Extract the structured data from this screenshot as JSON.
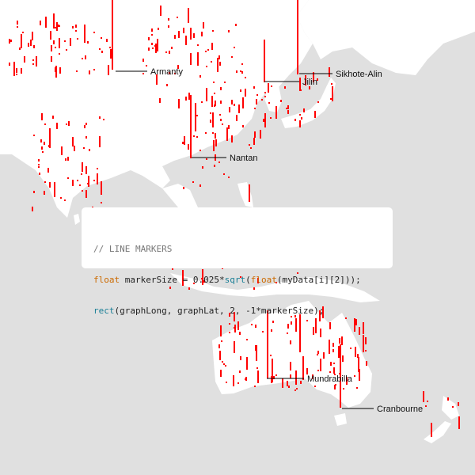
{
  "colors": {
    "ocean": "#e0e0e0",
    "land": "#ffffff",
    "marker": "#ff0000",
    "label": "#111111"
  },
  "places": [
    {
      "name": "Armanty"
    },
    {
      "name": "Jilin"
    },
    {
      "name": "Sikhote-Alin"
    },
    {
      "name": "Nantan"
    },
    {
      "name": "Mundrabilla"
    },
    {
      "name": "Cranbourne"
    }
  ],
  "code_overlay": {
    "comment": "// LINE MARKERS",
    "line1": {
      "type": "float",
      "var": " markerSize = 0.025*",
      "fn": "sqrt",
      "open": "(",
      "cast": "float",
      "rest": "(myData[i][2]));"
    },
    "line2": {
      "fn": "rect",
      "rest": "(graphLong, graphLat, 2, -1*markerSize);"
    }
  }
}
